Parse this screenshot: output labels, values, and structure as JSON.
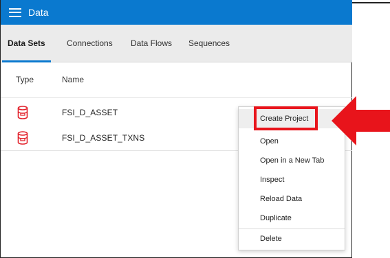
{
  "header": {
    "title": "Data",
    "menu_icon": "hamburger-menu-icon"
  },
  "tabs": [
    {
      "label": "Data Sets",
      "active": true
    },
    {
      "label": "Connections",
      "active": false
    },
    {
      "label": "Data Flows",
      "active": false
    },
    {
      "label": "Sequences",
      "active": false
    }
  ],
  "table": {
    "columns": [
      "Type",
      "Name"
    ],
    "rows": [
      {
        "type_icon": "dataset-cylinder-icon",
        "name": "FSI_D_ASSET"
      },
      {
        "type_icon": "dataset-cylinder-icon",
        "name": "FSI_D_ASSET_TXNS"
      }
    ]
  },
  "context_menu": {
    "items": [
      "Create Project",
      "Open",
      "Open in a New Tab",
      "Inspect",
      "Reload Data",
      "Duplicate",
      "Delete"
    ],
    "highlighted": "Create Project"
  },
  "annotation": {
    "highlight_color": "#e8141b",
    "arrow_icon": "red-left-arrow-icon"
  },
  "colors": {
    "header_bg": "#0a79cf",
    "tab_bar_bg": "#ebebeb",
    "dataset_icon": "#e2202a"
  }
}
